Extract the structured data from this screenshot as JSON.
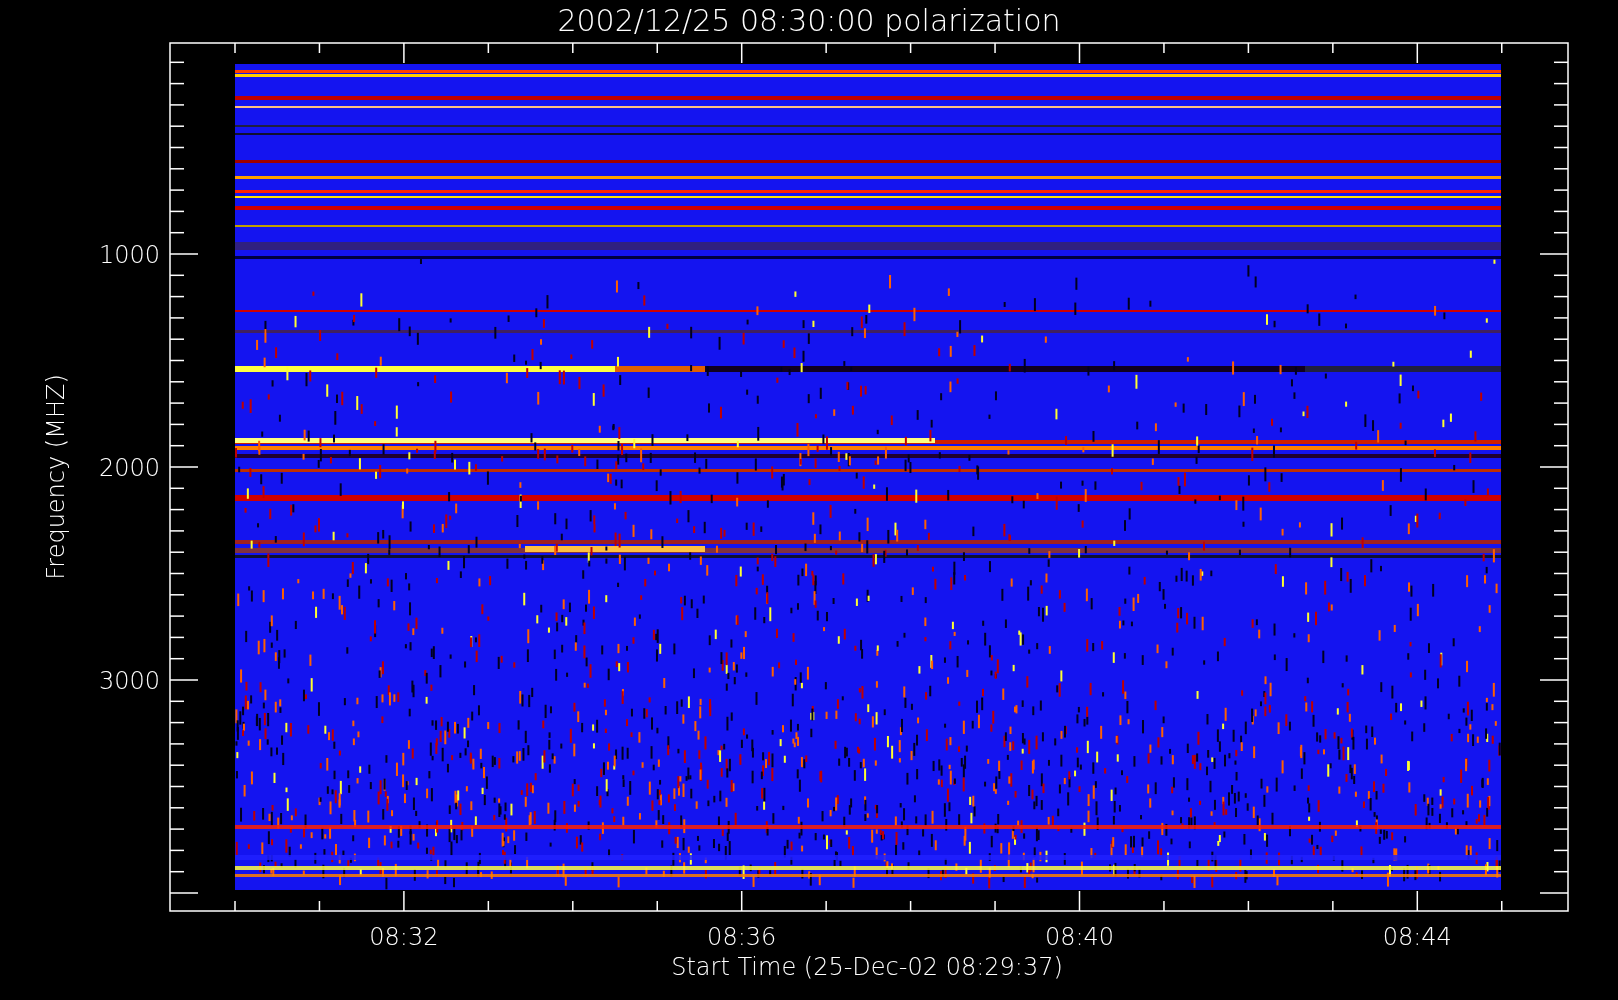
{
  "title": "2002/12/25 08:30:00 polarization",
  "y_axis": {
    "label": "Frequency (MHZ)",
    "ticks": [
      "1000",
      "2000",
      "3000"
    ]
  },
  "x_axis": {
    "label": "Start Time (25-Dec-02 08:29:37)",
    "ticks": [
      "08:32",
      "08:36",
      "08:40",
      "08:44"
    ]
  }
}
